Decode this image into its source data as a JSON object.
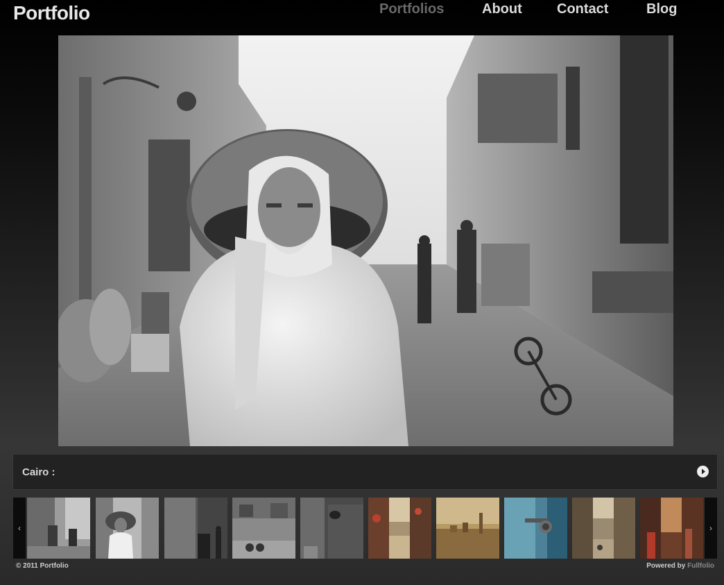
{
  "header": {
    "logo": "Portfolio",
    "nav": [
      {
        "label": "Portfolios",
        "active": true
      },
      {
        "label": "About",
        "active": false
      },
      {
        "label": "Contact",
        "active": false
      },
      {
        "label": "Blog",
        "active": false
      }
    ]
  },
  "gallery": {
    "caption": "Cairo :",
    "prev_arrow": "‹",
    "next_arrow": "›"
  },
  "footer": {
    "copyright": "© 2011 Portfolio",
    "powered_prefix": "Powered by",
    "powered_brand": "Fullfolio"
  },
  "colors": {
    "background_top": "#000000",
    "background_bottom": "#2a2a2a",
    "nav_active": "#6a6a6a",
    "nav_text": "#dcdcdc"
  }
}
